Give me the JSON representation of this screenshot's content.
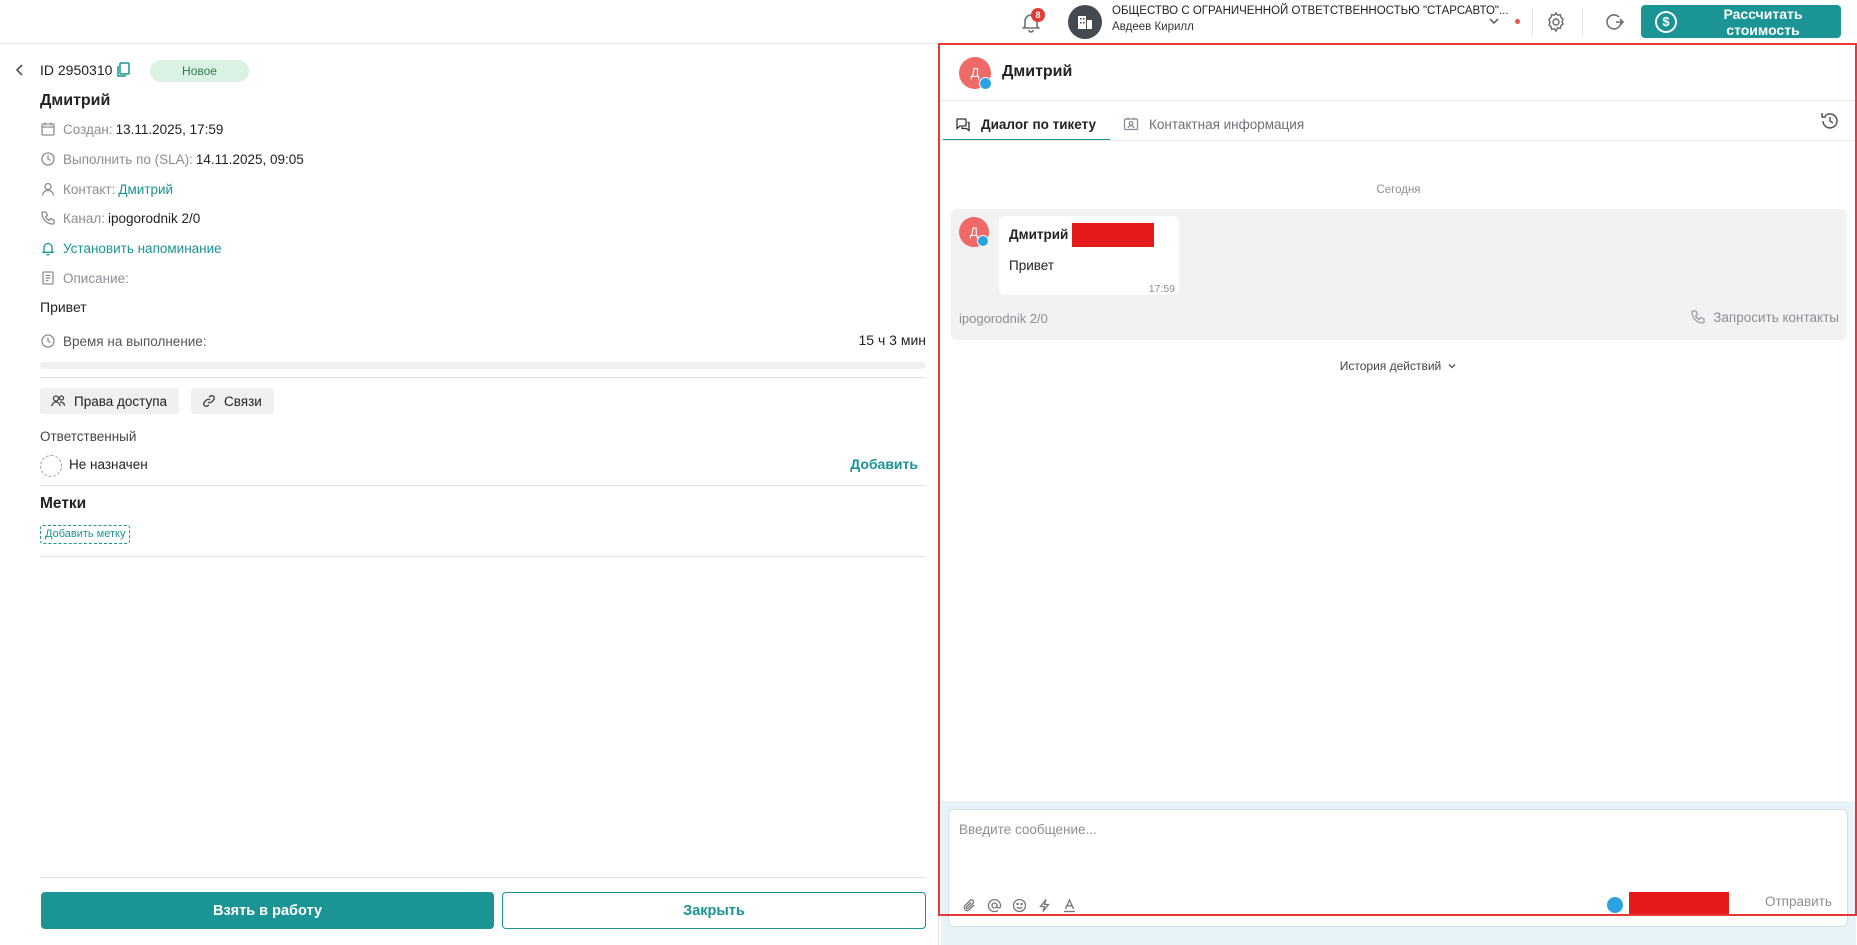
{
  "topbar": {
    "notifications_count": "8",
    "org_name": "ОБЩЕСТВО С ОГРАНИЧЕННОЙ ОТВЕТСТВЕННОСТЬЮ \"СТАРСАВТО\"...",
    "user_name": "Авдеев Кирилл",
    "calc_button": "Рассчитать стоимость",
    "accent_color": "#1a9494"
  },
  "ticket": {
    "id": "ID 2950310",
    "status": "Новое",
    "contact_name": "Дмитрий",
    "created_label": "Создан:",
    "created_value": "13.11.2025, 17:59",
    "sla_label": "Выполнить по (SLA):",
    "sla_value": "14.11.2025, 09:05",
    "contact_label": "Контакт:",
    "contact_value": "Дмитрий",
    "channel_label": "Канал:",
    "channel_value": "ipogorodnik 2/0",
    "reminder_link": "Установить напоминание",
    "description_label": "Описание:",
    "description_text": "Привет",
    "time_label": "Время на выполнение:",
    "time_value": "15 ч 3 мин",
    "time_progress_percent": 0
  },
  "access": {
    "rights_chip": "Права доступа",
    "links_chip": "Связи"
  },
  "responsible": {
    "label": "Ответственный",
    "value": "Не назначен",
    "add_link": "Добавить"
  },
  "tags": {
    "title": "Метки",
    "add_button": "Добавить метку"
  },
  "actions": {
    "take_button": "Взять в работу",
    "close_button": "Закрыть"
  },
  "chat": {
    "avatar_letter": "Д",
    "title": "Дмитрий",
    "tabs": [
      {
        "label": "Диалог по тикету",
        "active": true
      },
      {
        "label": "Контактная информация",
        "active": false
      }
    ],
    "date_separator": "Сегодня",
    "message": {
      "avatar_letter": "Д",
      "author": "Дмитрий",
      "text": "Привет",
      "time": "17:59"
    },
    "channel": "ipogorodnik 2/0",
    "request_contacts": "Запросить контакты",
    "actions_history": "История действий",
    "composer_placeholder": "Введите сообщение...",
    "send_button": "Отправить"
  }
}
